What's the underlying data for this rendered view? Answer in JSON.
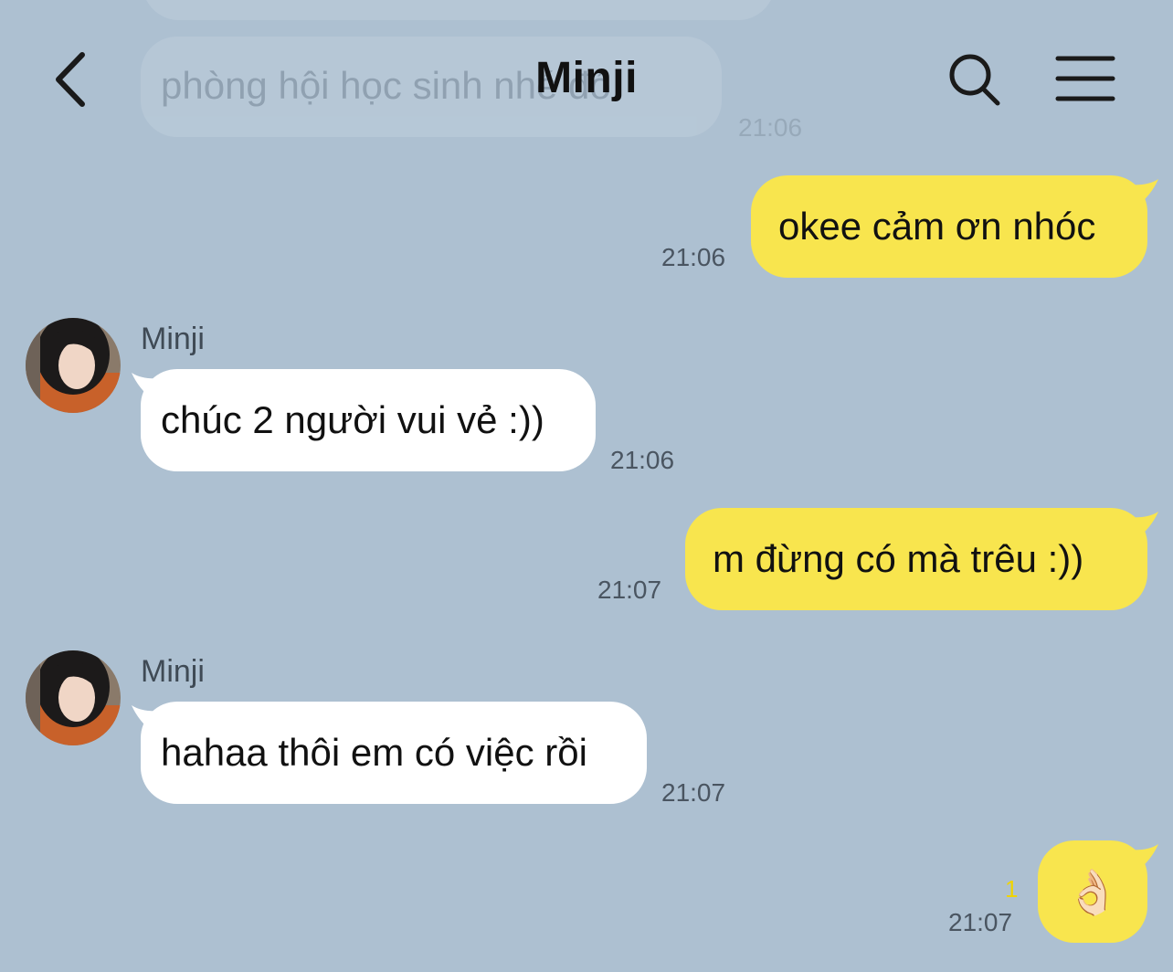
{
  "header": {
    "title": "Minji",
    "back_icon": "chevron-left-icon",
    "search_icon": "search-icon",
    "menu_icon": "hamburger-menu-icon"
  },
  "faded_previous": {
    "text": "phòng hội học sinh nhé đó",
    "time": "21:06"
  },
  "messages": [
    {
      "direction": "out",
      "text": "okee cảm ơn nhóc",
      "time": "21:06"
    },
    {
      "direction": "in",
      "sender": "Minji",
      "text": "chúc 2 người vui vẻ :))",
      "time": "21:06"
    },
    {
      "direction": "out",
      "text": "m đừng có mà trêu :))",
      "time": "21:07"
    },
    {
      "direction": "in",
      "sender": "Minji",
      "text": "hahaa thôi em có việc rồi",
      "time": "21:07"
    },
    {
      "direction": "out",
      "text": "👌🏻",
      "time": "21:07",
      "unread": "1"
    }
  ],
  "colors": {
    "background": "#adc0d1",
    "outgoing_bubble": "#f8e54e",
    "incoming_bubble": "#ffffff",
    "unread_count": "#f0d400"
  }
}
